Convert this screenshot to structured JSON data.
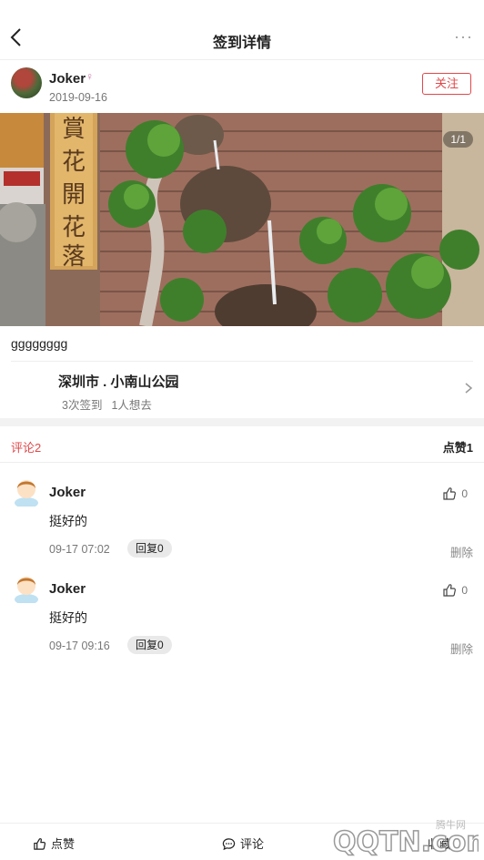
{
  "topbar": {
    "title": "签到详情",
    "more": "···"
  },
  "author": {
    "name": "Joker",
    "gender_symbol": "♀",
    "date": "2019-09-16",
    "follow_label": "关注"
  },
  "photo": {
    "counter": "1/1",
    "sign_text": "賞花開花落"
  },
  "post": {
    "text": "gggggggg"
  },
  "place": {
    "name": "深圳市 . 小南山公园",
    "checkins": "3次签到",
    "wants": "1人想去"
  },
  "comments_header": {
    "count_label": "评论2",
    "likes_label": "点赞1"
  },
  "comments": [
    {
      "name": "Joker",
      "text": "挺好的",
      "time": "09-17 07:02",
      "reply_label": "回复0",
      "like_count": "0",
      "delete_label": "删除"
    },
    {
      "name": "Joker",
      "text": "挺好的",
      "time": "09-17 09:16",
      "reply_label": "回复0",
      "like_count": "0",
      "delete_label": "删除"
    }
  ],
  "bottombar": {
    "like_label": "点赞",
    "comment_label": "评论",
    "collect_label": "收藏"
  },
  "watermark": {
    "small_text": "腾牛网",
    "logo_text": "QQTN.com"
  },
  "colors": {
    "accent": "#e0484a",
    "muted": "#777777"
  }
}
